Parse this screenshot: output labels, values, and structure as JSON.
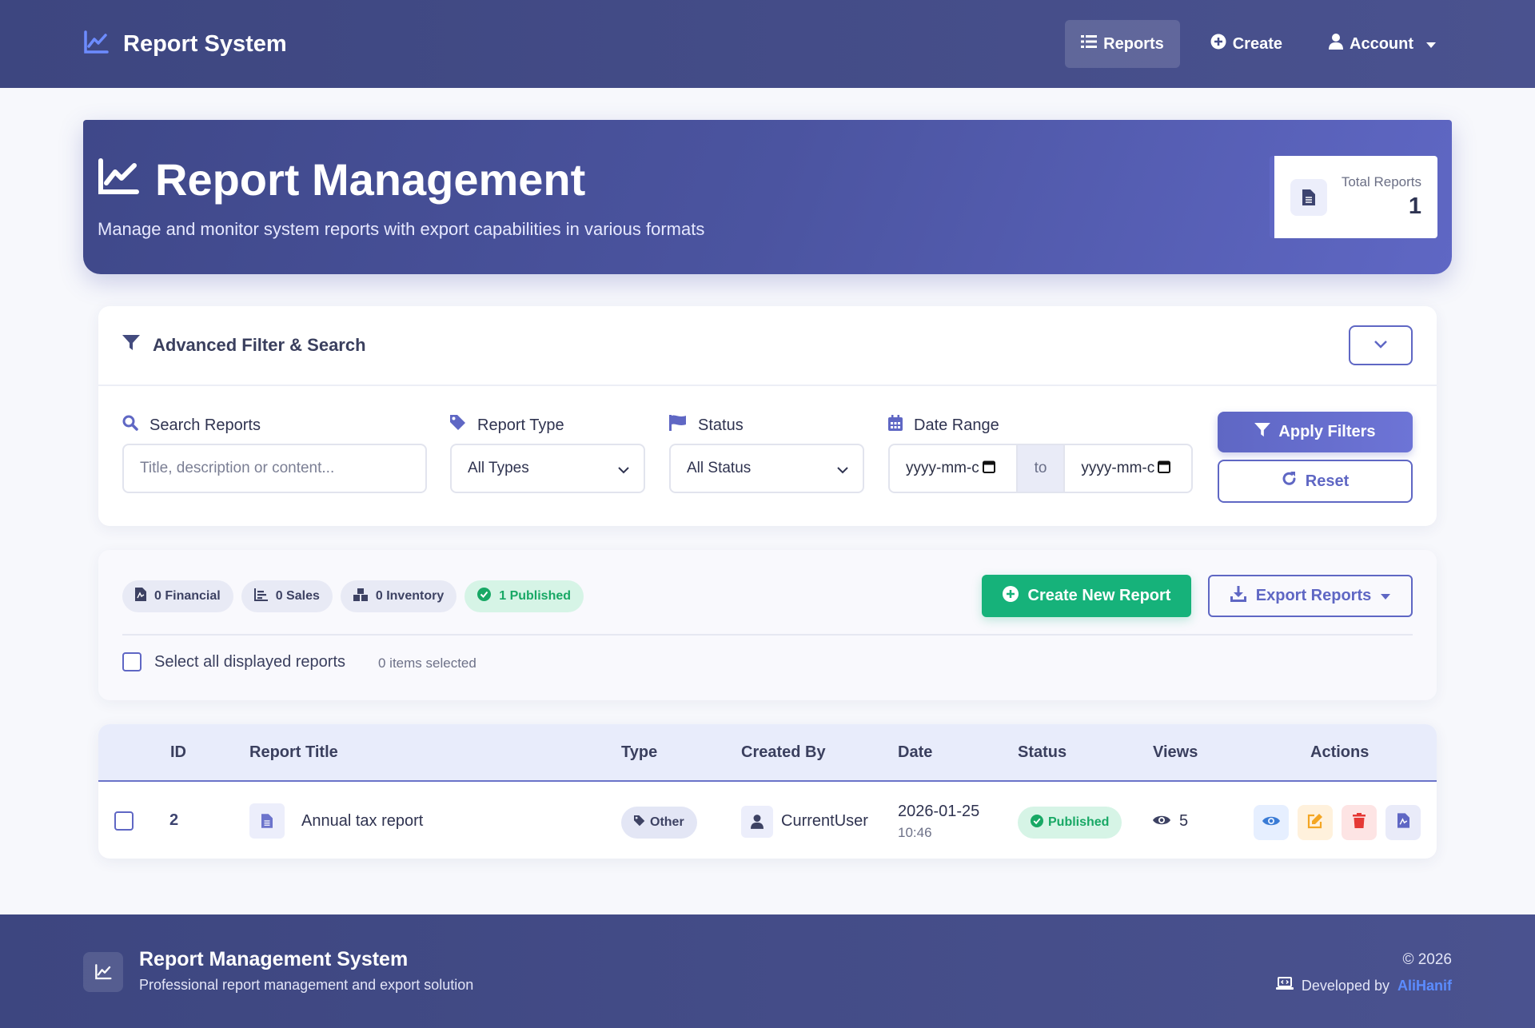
{
  "navbar": {
    "brand": "Report System",
    "items": [
      {
        "label": "Reports",
        "icon": "list-icon",
        "active": true
      },
      {
        "label": "Create",
        "icon": "plus-circle-icon"
      },
      {
        "label": "Account",
        "icon": "user-icon"
      }
    ]
  },
  "hero": {
    "title": "Report Management",
    "subtitle": "Manage and monitor system reports with export capabilities in various formats",
    "total_label": "Total Reports",
    "total_value": "1"
  },
  "filter": {
    "title": "Advanced Filter & Search",
    "search_label": "Search Reports",
    "search_placeholder": "Title, description or content...",
    "type_label": "Report Type",
    "type_value": "All Types",
    "status_label": "Status",
    "status_value": "All Status",
    "date_label": "Date Range",
    "date_from": "yyyy-mm-c",
    "date_to_label": "to",
    "date_to": "yyyy-mm-c",
    "apply_label": "Apply Filters",
    "reset_label": "Reset"
  },
  "stats": {
    "chips": [
      {
        "label": "0 Financial",
        "icon": "pdf-file-icon"
      },
      {
        "label": "0 Sales",
        "icon": "chart-bar-icon"
      },
      {
        "label": "0 Inventory",
        "icon": "boxes-icon"
      },
      {
        "label": "1 Published",
        "icon": "check-circle-icon"
      }
    ],
    "create_label": "Create New Report",
    "export_label": "Export Reports",
    "select_all_label": "Select all displayed reports",
    "selected_count": "0 items selected"
  },
  "table": {
    "headers": [
      "ID",
      "Report Title",
      "Type",
      "Created By",
      "Date",
      "Status",
      "Views",
      "Actions"
    ],
    "rows": [
      {
        "id": "2",
        "title": "Annual tax report",
        "type": "Other",
        "created_by": "CurrentUser",
        "date": "2026-01-25",
        "time": "10:46",
        "status": "Published",
        "views": "5"
      }
    ]
  },
  "footer": {
    "title": "Report Management System",
    "subtitle": "Professional report management and export solution",
    "copyright": "© 2026",
    "dev_prefix": "Developed by",
    "dev_name": "AliHanif"
  },
  "colors": {
    "primary": "#5f67c4",
    "nav": "#3d4680",
    "success": "#16b27a",
    "danger": "#e53935",
    "warning": "#f4a623"
  }
}
